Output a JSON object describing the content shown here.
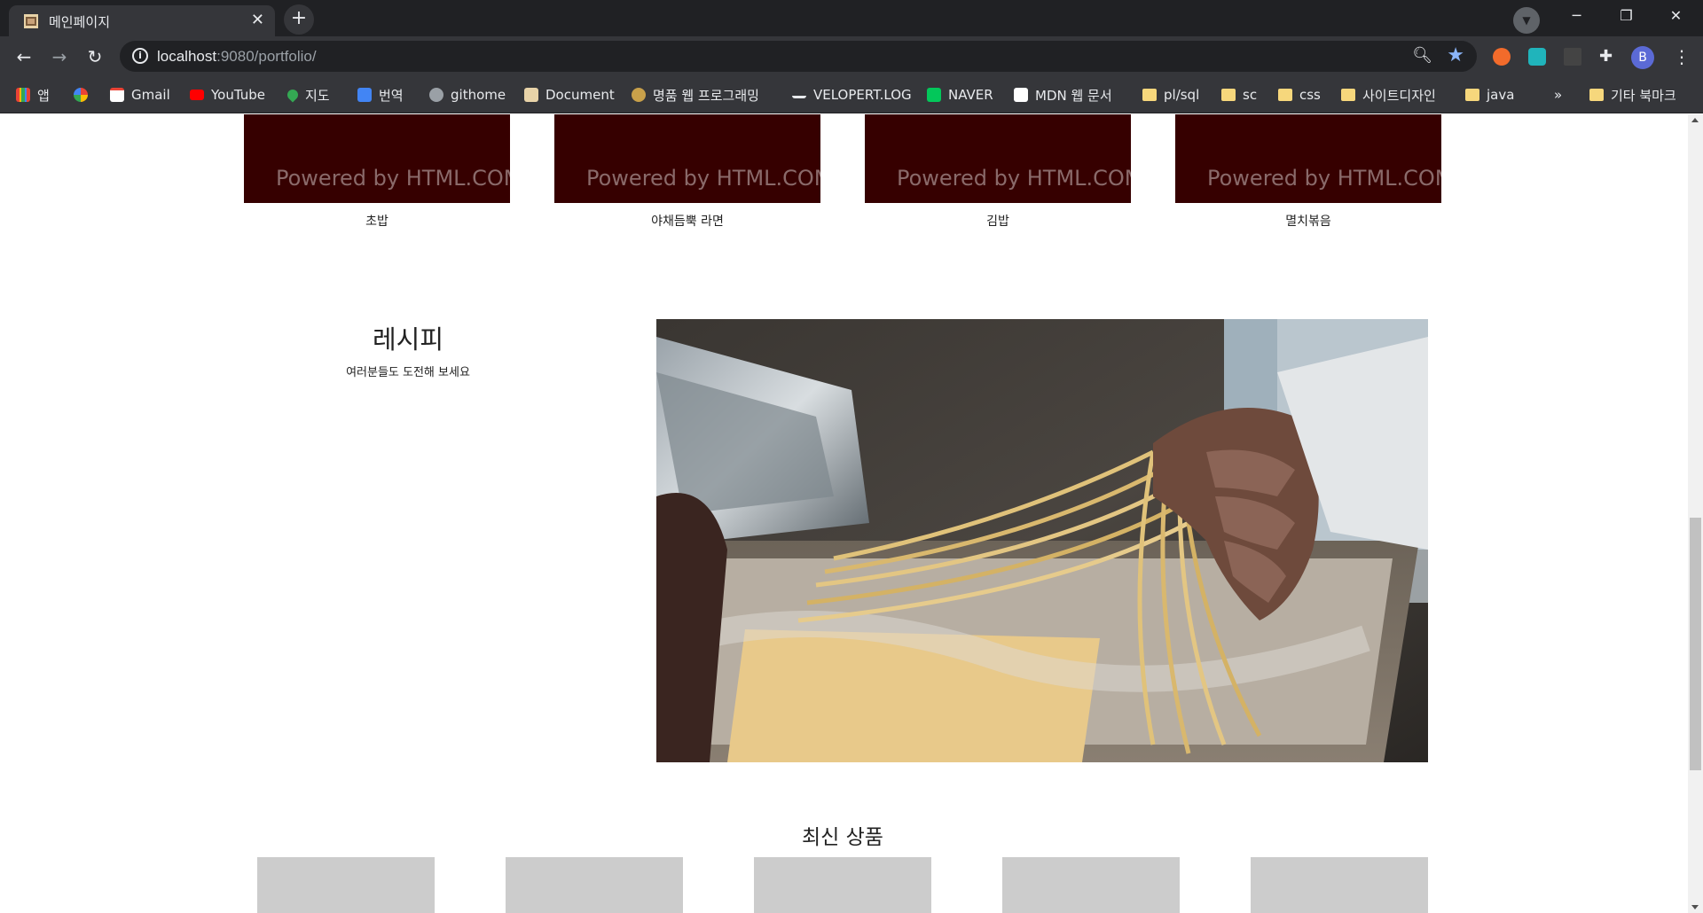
{
  "browser": {
    "tab_title": "메인페이지",
    "tab_close": "✕",
    "new_tab": "+",
    "url_host": "localhost",
    "url_rest": ":9080/portfolio/",
    "window": {
      "minimize": "─",
      "restore": "❐",
      "close": "✕"
    },
    "nav": {
      "back": "←",
      "forward": "→",
      "reload": "↻"
    },
    "avatar_letter": "B",
    "menu": "⋮",
    "bookmarks": [
      {
        "label": "앱",
        "icon": "apps-grid-icon"
      },
      {
        "label": "",
        "icon": "google-icon"
      },
      {
        "label": "Gmail",
        "icon": "gmail-icon"
      },
      {
        "label": "YouTube",
        "icon": "youtube-icon"
      },
      {
        "label": "지도",
        "icon": "maps-pin-icon"
      },
      {
        "label": "번역",
        "icon": "translate-icon"
      },
      {
        "label": "githome",
        "icon": "globe-icon"
      },
      {
        "label": "Document",
        "icon": "document-icon"
      },
      {
        "label": "명품 웹 프로그래밍",
        "icon": "book-icon"
      },
      {
        "label": "VELOPERT.LOG",
        "icon": "velopert-icon"
      },
      {
        "label": "NAVER",
        "icon": "naver-icon"
      },
      {
        "label": "MDN 웹 문서",
        "icon": "mdn-icon"
      },
      {
        "label": "pl/sql",
        "icon": "folder-icon"
      },
      {
        "label": "sc",
        "icon": "folder-icon"
      },
      {
        "label": "css",
        "icon": "folder-icon"
      },
      {
        "label": "사이트디자인",
        "icon": "folder-icon"
      },
      {
        "label": "java",
        "icon": "folder-icon"
      }
    ],
    "bookmarks_more": "»",
    "other_bookmarks": "기타 북마크"
  },
  "page": {
    "foods": [
      {
        "name": "초밥",
        "placeholder_text": "Powered by HTML.COM"
      },
      {
        "name": "야채듬뿍 라면",
        "placeholder_text": "Powered by HTML.COM"
      },
      {
        "name": "김밥",
        "placeholder_text": "Powered by HTML.COM"
      },
      {
        "name": "멸치볶음",
        "placeholder_text": "Powered by HTML.COM"
      }
    ],
    "recipe": {
      "title": "레시피",
      "subtitle": "여러분들도 도전해 보세요"
    },
    "new_products": {
      "title": "최신 상품",
      "count": 5
    }
  }
}
